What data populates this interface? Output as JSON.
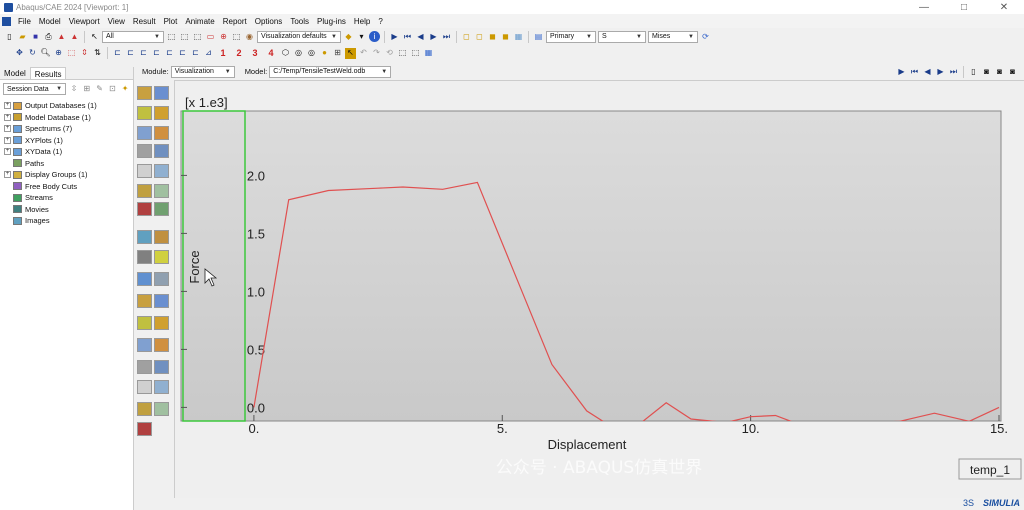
{
  "window": {
    "title": "Abaqus/CAE 2024 [Viewport: 1]",
    "controls": [
      "—",
      "□",
      "✕"
    ]
  },
  "menu": [
    "File",
    "Model",
    "Viewport",
    "View",
    "Result",
    "Plot",
    "Animate",
    "Report",
    "Options",
    "Tools",
    "Plug-ins",
    "Help",
    "?"
  ],
  "toolbar": {
    "selection_filter": "All",
    "visualization_defaults": "Visualization defaults",
    "step_buttons": [
      "1",
      "2",
      "3",
      "4"
    ],
    "primary": "Primary",
    "variable": "S",
    "invariant": "Mises"
  },
  "context": {
    "module_label": "Module:",
    "module_value": "Visualization",
    "model_label": "Model:",
    "model_value": "C:/Temp/TensileTestWeld.odb"
  },
  "left_panel": {
    "tabs": [
      "Model",
      "Results"
    ],
    "session_label": "Session Data",
    "tree": [
      {
        "label": "Output Databases (1)",
        "expand": true
      },
      {
        "label": "Model Database (1)",
        "expand": true
      },
      {
        "label": "Spectrums (7)",
        "expand": true
      },
      {
        "label": "XYPlots (1)",
        "expand": true
      },
      {
        "label": "XYData (1)",
        "expand": true
      },
      {
        "label": "Paths",
        "expand": false
      },
      {
        "label": "Display Groups (1)",
        "expand": true
      },
      {
        "label": "Free Body Cuts",
        "expand": false
      },
      {
        "label": "Streams",
        "expand": false
      },
      {
        "label": "Movies",
        "expand": false
      },
      {
        "label": "Images",
        "expand": false
      }
    ]
  },
  "plot": {
    "scale_label": "[x 1.e3]",
    "legend_label": "temp_1",
    "watermark": "公众号 · ABAQUS仿真世界",
    "brand": "SIMULIA"
  },
  "chart_data": {
    "type": "line",
    "xlabel": "Displacement",
    "ylabel": "Force",
    "xlim": [
      -0.3,
      15.0
    ],
    "ylim": [
      -0.1,
      2.4
    ],
    "x_ticks": [
      "0.",
      "5.",
      "10.",
      "15."
    ],
    "y_ticks": [
      "0.0",
      "0.5",
      "1.0",
      "1.5",
      "2.0"
    ],
    "series": [
      {
        "name": "temp_1",
        "color": "#e05050",
        "x": [
          0.0,
          0.7,
          1.5,
          2.5,
          3.0,
          3.8,
          4.5,
          5.3,
          6.0,
          6.7,
          7.1,
          7.8,
          8.3,
          8.8,
          9.5,
          10.0,
          10.5,
          11.0,
          12.0,
          13.0,
          13.7,
          14.4,
          15.0
        ],
        "y": [
          0.0,
          1.79,
          1.87,
          1.89,
          1.9,
          1.88,
          1.94,
          1.1,
          0.37,
          -0.03,
          -0.14,
          -0.13,
          0.04,
          -0.1,
          -0.13,
          -0.08,
          -0.07,
          -0.15,
          -0.14,
          -0.12,
          -0.05,
          -0.12,
          0.0
        ]
      }
    ]
  },
  "colors": {
    "curve": "#e05050",
    "plot_bg": "#d4d4d4",
    "selection_green": "#3cc83c",
    "brand_blue": "#1a4fa0"
  }
}
